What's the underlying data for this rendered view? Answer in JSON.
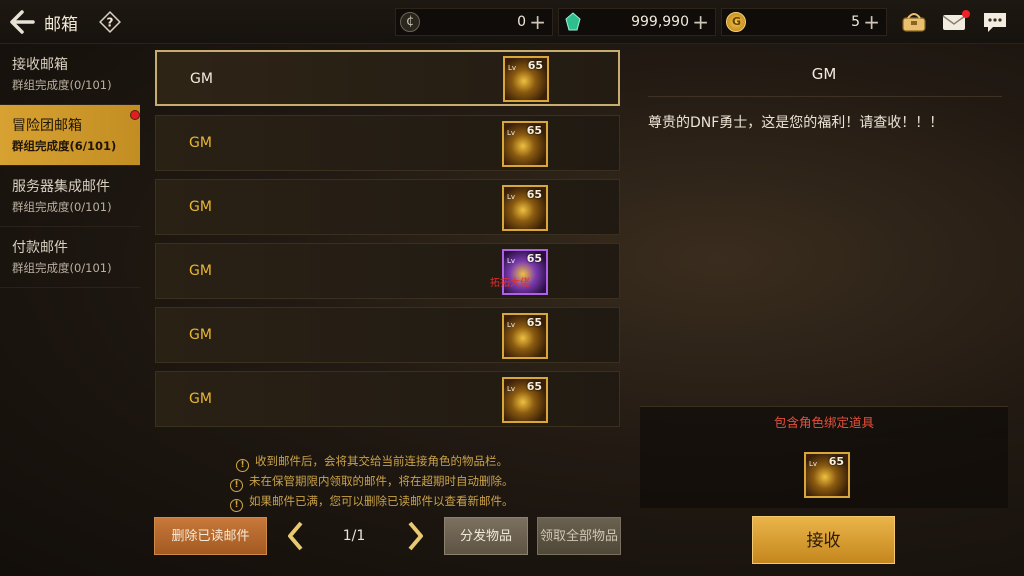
{
  "header": {
    "title": "邮箱",
    "help_icon": "?",
    "currencies": [
      {
        "name": "coin-c",
        "value": "0",
        "plus": "+",
        "color": "#8a8474"
      },
      {
        "name": "gem",
        "value": "999,990",
        "plus": "+",
        "color": "#3ecfa0"
      },
      {
        "name": "gold",
        "value": "5",
        "plus": "+",
        "color": "#e2a52a"
      }
    ],
    "icons": [
      "bag-icon",
      "mail-icon",
      "chat-icon"
    ]
  },
  "sidebar": {
    "items": [
      {
        "label": "接收邮箱",
        "sub": "群组完成度(0/101)",
        "active": false
      },
      {
        "label": "冒险团邮箱",
        "sub": "群组完成度(6/101)",
        "active": true,
        "badge": true
      },
      {
        "label": "服务器集成邮件",
        "sub": "群组完成度(0/101)",
        "active": false
      },
      {
        "label": "付款邮件",
        "sub": "群组完成度(0/101)",
        "active": false
      }
    ]
  },
  "mail_list": [
    {
      "sender": "GM",
      "item_lv": "Lv",
      "item_level": "65",
      "selected": true,
      "rarity": "gold"
    },
    {
      "sender": "GM",
      "item_lv": "Lv",
      "item_level": "65",
      "selected": false,
      "rarity": "gold"
    },
    {
      "sender": "GM",
      "item_lv": "Lv",
      "item_level": "65",
      "selected": false,
      "rarity": "gold"
    },
    {
      "sender": "GM",
      "item_lv": "Lv",
      "item_level": "65",
      "selected": false,
      "rarity": "purple",
      "watermark": "拓拓大佬"
    },
    {
      "sender": "GM",
      "item_lv": "Lv",
      "item_level": "65",
      "selected": false,
      "rarity": "gold"
    },
    {
      "sender": "GM",
      "item_lv": "Lv",
      "item_level": "65",
      "selected": false,
      "rarity": "gold"
    }
  ],
  "notices": [
    "收到邮件后，会将其交给当前连接角色的物品栏。",
    "未在保管期限内领取的邮件，将在超期时自动删除。",
    "如果邮件已满，您可以删除已读邮件以查看新邮件。"
  ],
  "notice_icon": "!",
  "bottom": {
    "delete_read": "删除已读邮件",
    "page": "1/1",
    "distribute": "分发物品",
    "claim_all": "领取全部物品"
  },
  "detail": {
    "sender": "GM",
    "body": "尊贵的DNF勇士，这是您的福利！请查收！！！",
    "attach_header": "包含角色绑定道具",
    "attach_item_lv": "Lv",
    "attach_item_level": "65",
    "receive": "接收"
  }
}
